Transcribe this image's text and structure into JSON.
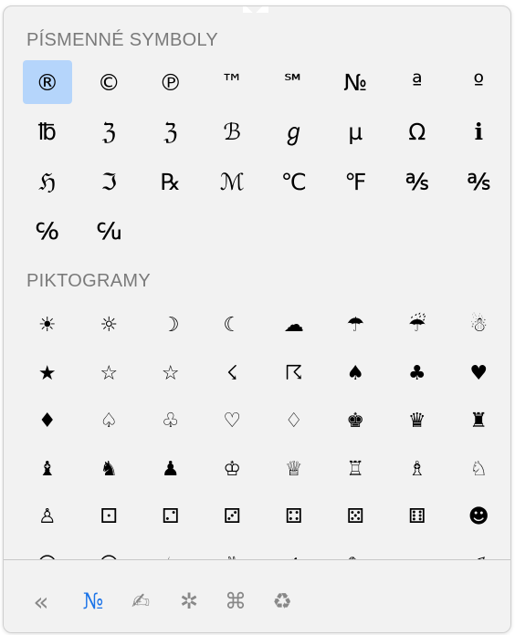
{
  "sections": [
    {
      "title": "PÍSMENNÉ SYMBOLY",
      "symbols": [
        "®",
        "©",
        "℗",
        "™",
        "℠",
        "№",
        "ª",
        "º",
        "℔",
        "ℨ",
        "ℨ",
        "ℬ",
        "ℊ",
        "µ",
        "Ω",
        "ℹ",
        "ℌ",
        "ℑ",
        "℞",
        "ℳ",
        "℃",
        "℉",
        "℁",
        "℁",
        "℅",
        "℆"
      ],
      "selected_index": 0
    },
    {
      "title": "PIKTOGRAMY",
      "symbols": [
        "☀",
        "☼",
        "☽",
        "☾",
        "☁",
        "☂",
        "☔",
        "☃",
        "★",
        "☆",
        "☆",
        "☇",
        "☈",
        "♠",
        "♣",
        "♥",
        "♦",
        "♤",
        "♧",
        "♡",
        "♢",
        "♚",
        "♛",
        "♜",
        "♝",
        "♞",
        "♟",
        "♔",
        "♕",
        "♖",
        "♗",
        "♘",
        "♙",
        "⚀",
        "⚁",
        "⚂",
        "⚃",
        "⚄",
        "⚅",
        "☻",
        "☹",
        "☺",
        "☕",
        "✌",
        "✍",
        "✎",
        "✏",
        "✐"
      ]
    }
  ],
  "toolbar": [
    {
      "name": "back",
      "glyph": "«",
      "active": false
    },
    {
      "name": "letterlike",
      "glyph": "№",
      "active": true
    },
    {
      "name": "pictographs",
      "glyph": "✍",
      "active": false
    },
    {
      "name": "asterisk",
      "glyph": "✲",
      "active": false
    },
    {
      "name": "technical",
      "glyph": "⌘",
      "active": false
    },
    {
      "name": "recycle",
      "glyph": "♻",
      "active": false
    }
  ],
  "colors": {
    "selection": "#b5d5fb",
    "active_tool": "#1a73e8",
    "inactive_tool": "#888888",
    "section_title": "#7a7a7a"
  }
}
